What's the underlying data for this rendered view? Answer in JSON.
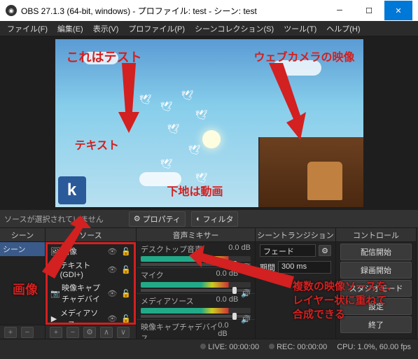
{
  "window": {
    "title": "OBS 27.1.3 (64-bit, windows) - プロファイル: test - シーン: test"
  },
  "menu": {
    "file": "ファイル(F)",
    "edit": "編集(E)",
    "view": "表示(V)",
    "profile": "プロファイル(P)",
    "scene_col": "シーンコレクション(S)",
    "tools": "ツール(T)",
    "help": "ヘルプ(H)"
  },
  "overlay": {
    "test_text": "これはテスト",
    "text_label": "テキスト",
    "webcam_label": "ウェブカメラの映像",
    "base_video": "下地は動画",
    "klogo": "k"
  },
  "toolbar": {
    "no_source": "ソースが選択されていません",
    "properties": "プロパティ",
    "filters": "フィルタ"
  },
  "panels": {
    "scenes": "シーン",
    "sources": "ソース",
    "mixer": "音声ミキサー",
    "transition": "シーントランジション",
    "controls": "コントロール"
  },
  "scenes": {
    "item0": "シーン"
  },
  "sources": {
    "items": [
      {
        "icon": "🖼",
        "label": "画像"
      },
      {
        "icon": "T",
        "label": "テキスト (GDI+)"
      },
      {
        "icon": "📷",
        "label": "映像キャプチャデバイ"
      },
      {
        "icon": "▶",
        "label": "メディアソース"
      }
    ]
  },
  "mixer": {
    "tracks": [
      {
        "name": "デスクトップ音声",
        "db": "0.0 dB"
      },
      {
        "name": "マイク",
        "db": "0.0 dB"
      },
      {
        "name": "メディアソース",
        "db": "0.0 dB"
      },
      {
        "name": "映像キャプチャデバイス",
        "db": "0.0 dB"
      }
    ]
  },
  "transition": {
    "type": "フェード",
    "duration_label": "期間",
    "duration": "300 ms"
  },
  "controls": {
    "stream": "配信開始",
    "record": "録画開始",
    "studio": "スタジオモード",
    "settings": "設定",
    "exit": "終了"
  },
  "status": {
    "live": "LIVE: 00:00:00",
    "rec": "REC: 00:00:00",
    "cpu": "CPU: 1.0%, 60.00 fps"
  },
  "annotations": {
    "image": "画像",
    "multi1": "複数の映像ソースを、",
    "multi2": "レイヤー状に重ねて",
    "multi3": "合成できる"
  }
}
